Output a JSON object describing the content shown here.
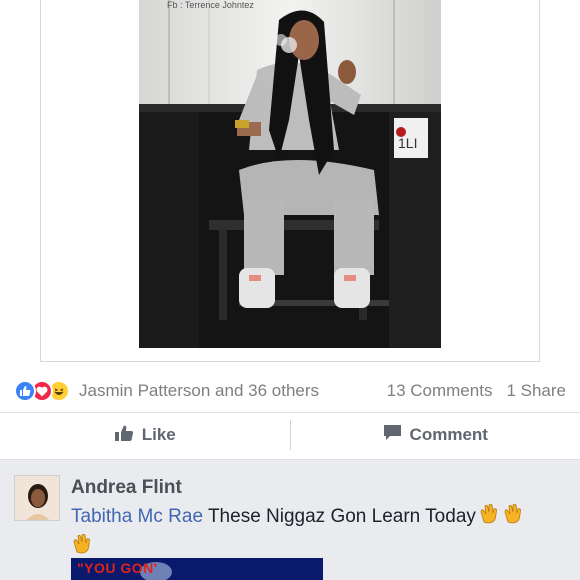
{
  "post": {
    "photo_caption": "Fb : Terrence Johntez"
  },
  "reactions": {
    "icons": [
      "like-icon",
      "love-icon",
      "haha-icon"
    ],
    "names": "Jasmin Patterson and 36 others",
    "comments_count": "13 Comments",
    "shares_count": "1 Share"
  },
  "actions": {
    "like_label": "Like",
    "comment_label": "Comment"
  },
  "comment": {
    "author": "Andrea Flint",
    "mention": "Tabitha Mc Rae",
    "text": "These Niggaz Gon Learn Today",
    "emoji": "clapping-hands-icon"
  },
  "gif": {
    "text": "\"YOU GON'"
  },
  "colors": {
    "like_blue": "#3b82f6",
    "love_red": "#f0284a",
    "haha_yellow": "#ffcf34",
    "mention_blue": "#4267b2",
    "muted_text": "#7f7f7f",
    "background": "#e9ebee"
  }
}
